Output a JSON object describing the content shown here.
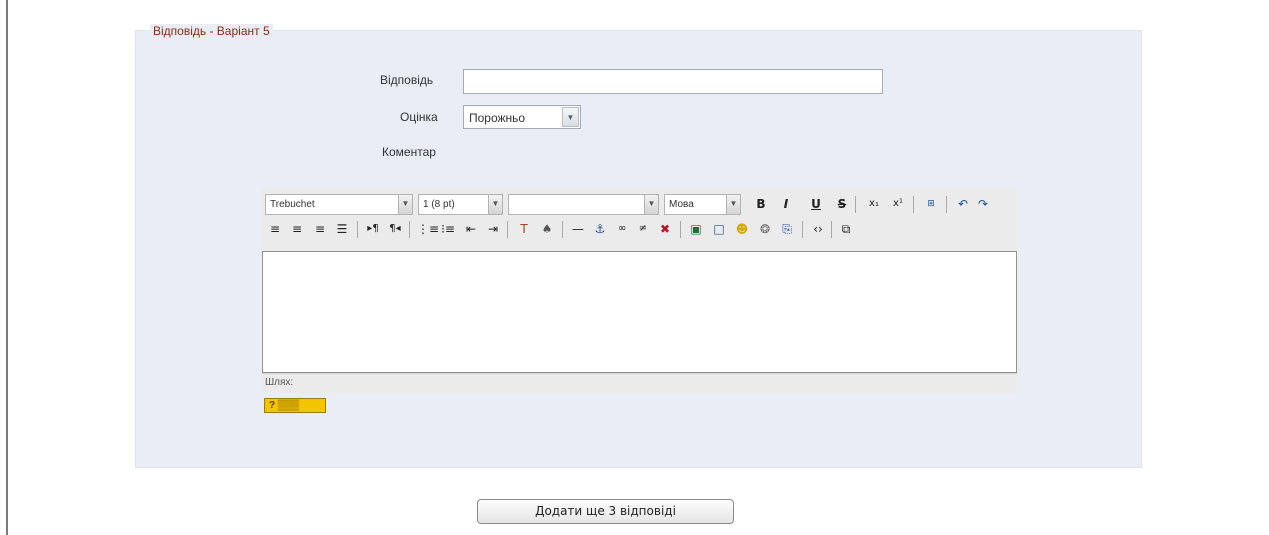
{
  "section": {
    "legend": "Відповідь - Варіант 5"
  },
  "form": {
    "answer_label": "Відповідь",
    "answer_value": "",
    "grade_label": "Оцінка",
    "grade_value": "Порожньо",
    "comment_label": "Коментар"
  },
  "editor": {
    "font_family": "Trebuchet",
    "font_size": "1 (8 pt)",
    "style": "",
    "language": "Мова",
    "path_label": "Шлях:"
  },
  "actions": {
    "add_more": "Додати ще 3 відповіді"
  }
}
